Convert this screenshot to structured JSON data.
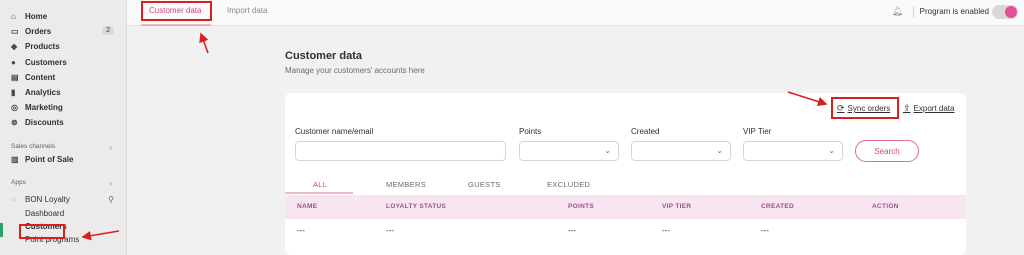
{
  "sidebar": {
    "main_items": [
      {
        "label": "Home",
        "icon": "home-icon",
        "glyph": "⌂"
      },
      {
        "label": "Orders",
        "icon": "orders-icon",
        "glyph": "▭",
        "badge": "2"
      },
      {
        "label": "Products",
        "icon": "tag-icon",
        "glyph": "◆"
      },
      {
        "label": "Customers",
        "icon": "person-icon",
        "glyph": "●"
      },
      {
        "label": "Content",
        "icon": "content-icon",
        "glyph": "▤"
      },
      {
        "label": "Analytics",
        "icon": "analytics-icon",
        "glyph": "▮"
      },
      {
        "label": "Marketing",
        "icon": "marketing-icon",
        "glyph": "◎"
      },
      {
        "label": "Discounts",
        "icon": "discount-icon",
        "glyph": "⊗"
      }
    ],
    "sales_channels_label": "Sales channels",
    "point_of_sale": {
      "label": "Point of Sale",
      "icon": "store-icon",
      "glyph": "▥"
    },
    "apps_label": "Apps",
    "app": {
      "label": "BON Loyalty",
      "icon": "app-icon",
      "glyph": "◌"
    },
    "app_subitems": [
      {
        "label": "Dashboard"
      },
      {
        "label": "Customers",
        "active": true
      },
      {
        "label": "Point programs"
      }
    ]
  },
  "topbar": {
    "tabs": [
      {
        "label": "Customer data",
        "active": true
      },
      {
        "label": "Import data",
        "active": false
      }
    ],
    "program_status": "Program is enabled",
    "toggle_on": true
  },
  "page": {
    "title": "Customer data",
    "subtitle": "Manage your customers' accounts here"
  },
  "actions": {
    "sync_orders": "Sync orders",
    "export_data": "Export data"
  },
  "filters": {
    "name_label": "Customer name/email",
    "name_value": "",
    "points_label": "Points",
    "created_label": "Created",
    "vip_label": "VIP Tier",
    "search_button": "Search"
  },
  "filter_tabs": [
    {
      "label": "ALL",
      "active": true
    },
    {
      "label": "MEMBERS",
      "active": false
    },
    {
      "label": "GUESTS",
      "active": false
    },
    {
      "label": "EXCLUDED",
      "active": false
    }
  ],
  "table": {
    "columns": [
      "NAME",
      "LOYALTY STATUS",
      "POINTS",
      "VIP TIER",
      "CREATED",
      "ACTION"
    ],
    "rows": [
      [
        "---",
        "---",
        "---",
        "---",
        "---",
        ""
      ]
    ]
  },
  "colors": {
    "accent": "#d4477f",
    "annotation": "#d92020",
    "table_header_bg": "#f7e6f2"
  }
}
